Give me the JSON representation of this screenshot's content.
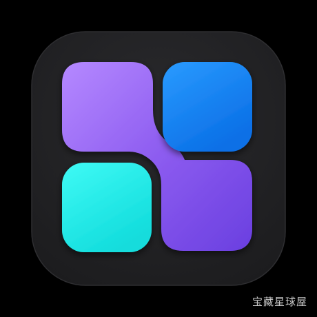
{
  "icon": {
    "name": "widget-grid-app-icon",
    "colors": {
      "background": "#000000",
      "squircle": "#222224",
      "squircle_edge": "#2e2e31",
      "purple_top": "#b589ff",
      "purple_mid": "#8d5cf0",
      "purple_bottom": "#6a3fe0",
      "blue_top": "#2a9bff",
      "blue_bottom": "#0a6fe6",
      "cyan_top": "#3ffaf5",
      "cyan_bottom": "#12dcdc"
    }
  },
  "watermark": {
    "text": "宝藏星球屋",
    "color": "#c9c9c9"
  }
}
